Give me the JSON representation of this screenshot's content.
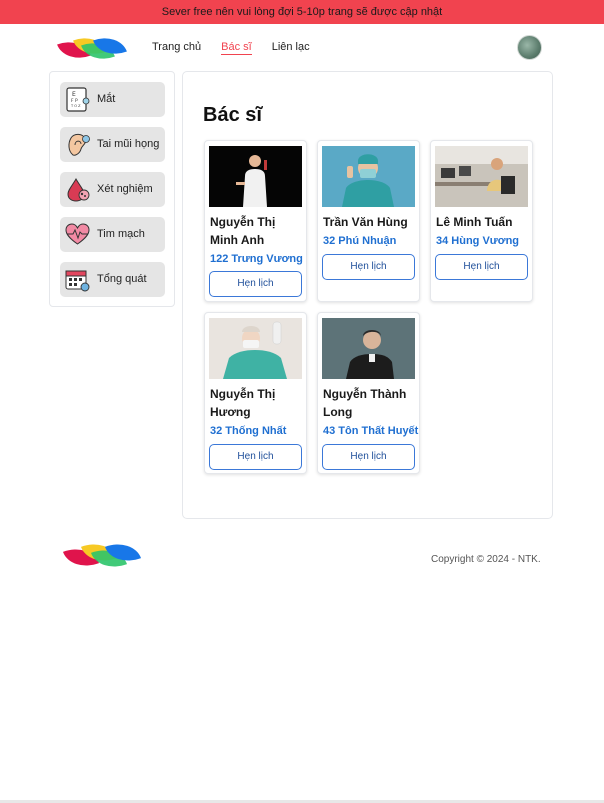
{
  "banner": {
    "text": "Sever free nên vui lòng đợi 5-10p trang sẽ được cập nhật"
  },
  "nav": {
    "home": "Trang chủ",
    "doctors": "Bác sĩ",
    "contact": "Liên lạc"
  },
  "sidebar": {
    "items": [
      {
        "label": "Mắt",
        "icon": "eye-chart-icon"
      },
      {
        "label": "Tai mũi họng",
        "icon": "ear-icon"
      },
      {
        "label": "Xét nghiệm",
        "icon": "blood-drop-icon"
      },
      {
        "label": "Tim mạch",
        "icon": "heart-icon"
      },
      {
        "label": "Tổng quát",
        "icon": "calendar-icon"
      }
    ]
  },
  "main": {
    "title": "Bác sĩ",
    "doctors": [
      {
        "name": "Nguyễn Thị Minh Anh",
        "address": "122 Trưng Vương",
        "button": "Hẹn lịch"
      },
      {
        "name": "Trần Văn Hùng",
        "address": "32 Phú Nhuận",
        "button": "Hẹn lịch"
      },
      {
        "name": "Lê Minh Tuấn",
        "address": "34 Hùng Vương",
        "button": "Hẹn lịch"
      },
      {
        "name": "Nguyễn Thị Hương",
        "address": "32 Thống Nhất",
        "button": "Hẹn lịch"
      },
      {
        "name": "Nguyễn Thành Long",
        "address": "43 Tôn Thất Huyết",
        "button": "Hẹn lịch"
      }
    ]
  },
  "footer": {
    "copyright": "Copyright © 2024 - NTK."
  },
  "colors": {
    "banner": "#f1434f",
    "accent_link": "#1f6fd1",
    "button_border": "#3b78d8"
  }
}
